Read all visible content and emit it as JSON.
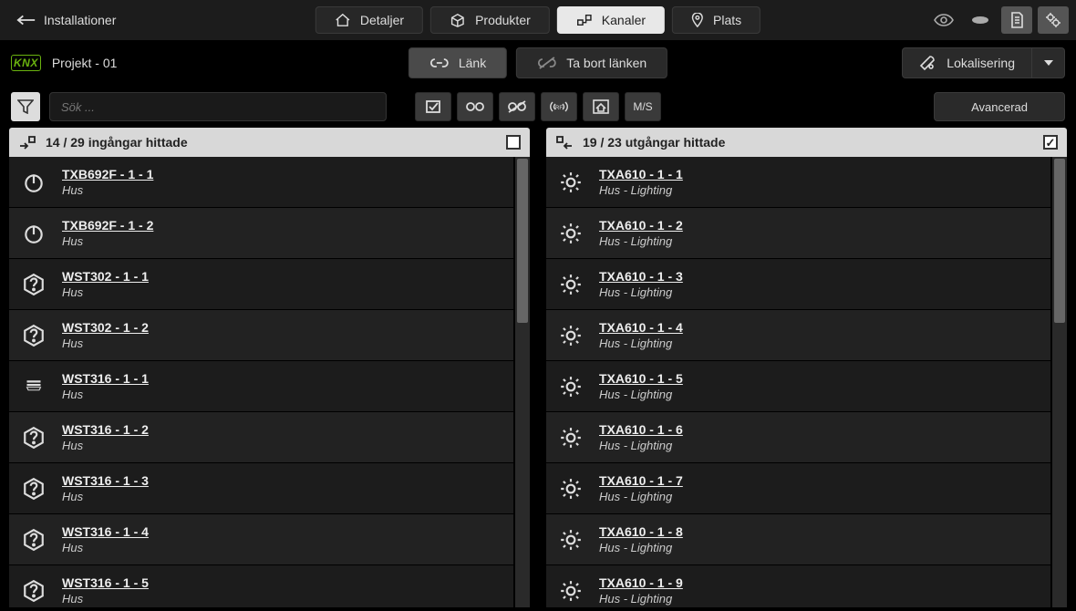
{
  "back_label": "Installationer",
  "nav": {
    "detaljer": "Detaljer",
    "produkter": "Produkter",
    "kanaler": "Kanaler",
    "plats": "Plats"
  },
  "project": {
    "logo_text": "KNX",
    "name": "Projekt - 01"
  },
  "subbar": {
    "link": "Länk",
    "unlink": "Ta bort länken",
    "localize": "Lokalisering"
  },
  "filterbar": {
    "search_placeholder": "Sök ...",
    "ms_label": "M/S",
    "advanced": "Avancerad"
  },
  "left_panel": {
    "header": "14 / 29 ingångar hittade",
    "items": [
      {
        "title": "TXB692F - 1 - 1",
        "sub": "Hus",
        "icon": "power"
      },
      {
        "title": "TXB692F - 1 - 2",
        "sub": "Hus",
        "icon": "power"
      },
      {
        "title": "WST302 - 1 - 1",
        "sub": "Hus",
        "icon": "question"
      },
      {
        "title": "WST302 - 1 - 2",
        "sub": "Hus",
        "icon": "question"
      },
      {
        "title": "WST316 - 1 - 1",
        "sub": "Hus",
        "icon": "blinds"
      },
      {
        "title": "WST316 - 1 - 2",
        "sub": "Hus",
        "icon": "question"
      },
      {
        "title": "WST316 - 1 - 3",
        "sub": "Hus",
        "icon": "question"
      },
      {
        "title": "WST316 - 1 - 4",
        "sub": "Hus",
        "icon": "question"
      },
      {
        "title": "WST316 - 1 - 5",
        "sub": "Hus",
        "icon": "question"
      }
    ]
  },
  "right_panel": {
    "header": "19 / 23 utgångar hittade",
    "items": [
      {
        "title": "TXA610 - 1 - 1",
        "sub": "Hus - Lighting",
        "icon": "light"
      },
      {
        "title": "TXA610 - 1 - 2",
        "sub": "Hus - Lighting",
        "icon": "light"
      },
      {
        "title": "TXA610 - 1 - 3",
        "sub": "Hus - Lighting",
        "icon": "light"
      },
      {
        "title": "TXA610 - 1 - 4",
        "sub": "Hus - Lighting",
        "icon": "light"
      },
      {
        "title": "TXA610 - 1 - 5",
        "sub": "Hus - Lighting",
        "icon": "light"
      },
      {
        "title": "TXA610 - 1 - 6",
        "sub": "Hus - Lighting",
        "icon": "light"
      },
      {
        "title": "TXA610 - 1 - 7",
        "sub": "Hus - Lighting",
        "icon": "light"
      },
      {
        "title": "TXA610 - 1 - 8",
        "sub": "Hus - Lighting",
        "icon": "light"
      },
      {
        "title": "TXA610 - 1 - 9",
        "sub": "Hus - Lighting",
        "icon": "light"
      }
    ]
  }
}
